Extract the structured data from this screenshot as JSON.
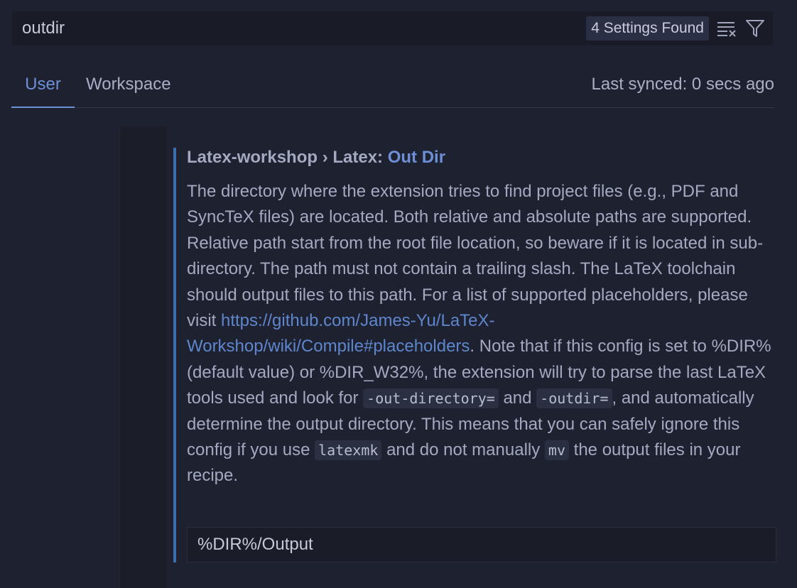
{
  "search": {
    "value": "outdir",
    "results_badge": "4 Settings Found",
    "clear_icon": "clear-filter-icon",
    "filter_icon": "filter-icon"
  },
  "tabs": [
    {
      "label": "User",
      "active": true
    },
    {
      "label": "Workspace",
      "active": false
    }
  ],
  "sync_status": "Last synced: 0 secs ago",
  "setting": {
    "title_prefix": "Latex-workshop › Latex: ",
    "title_key": "Out Dir",
    "desc_1": "The directory where the extension tries to find project files (e.g., PDF and SyncTeX files) are located. Both relative and absolute paths are supported. Relative path start from the root file location, so beware if it is located in sub-directory. The path must not contain a trailing slash. The LaTeX toolchain should output files to this path. For a list of supported placeholders, please visit ",
    "link": "https://github.com/James-Yu/LaTeX-Workshop/wiki/Compile#placeholders",
    "desc_2": ". Note that if this config is set to %DIR% (default value) or %DIR_W32%, the extension will try to parse the last LaTeX tools used and look for ",
    "code_1": "-out-directory=",
    "desc_3": " and ",
    "code_2": "-outdir=",
    "desc_4": ", and automatically determine the output directory. This means that you can safely ignore this config if you use ",
    "code_3": "latexmk",
    "desc_5": " and do not manually ",
    "code_4": "mv",
    "desc_6": " the output files in your recipe.",
    "value": "%DIR%/Output"
  },
  "colors": {
    "background": "#1e2130",
    "accent": "#6d8fd6",
    "modified_indicator": "#3a6fb0"
  }
}
